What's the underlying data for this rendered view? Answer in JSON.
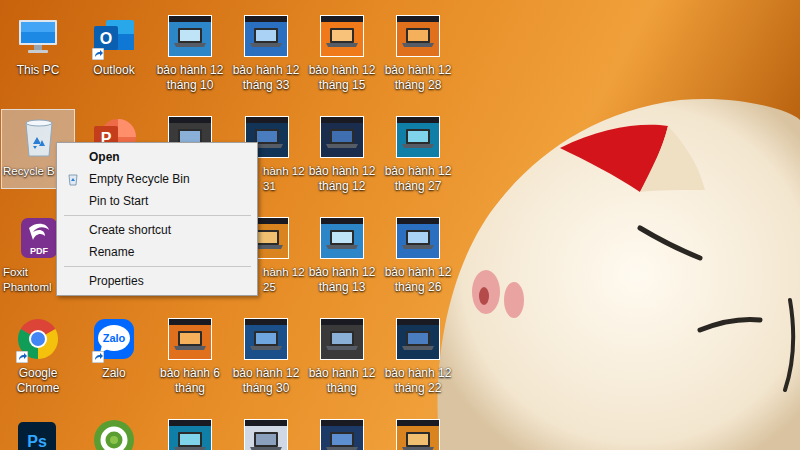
{
  "desktop": {
    "columns": [
      [
        {
          "label": "This PC",
          "kind": "this-pc",
          "glyph": "",
          "shortcut": false,
          "selected": false
        },
        {
          "label": "Recycle B",
          "kind": "recycle-bin",
          "glyph": "",
          "shortcut": false,
          "selected": true
        },
        {
          "label": "Foxit\nPhantoml",
          "kind": "foxit",
          "glyph": "PDF",
          "shortcut": false,
          "selected": false
        },
        {
          "label": "Google Chrome",
          "kind": "chrome",
          "glyph": "",
          "shortcut": true,
          "selected": false
        },
        {
          "label": "",
          "kind": "photoshop",
          "glyph": "Ps",
          "shortcut": false,
          "selected": false
        }
      ],
      [
        {
          "label": "Outlook",
          "kind": "outlook",
          "glyph": "O",
          "shortcut": true,
          "selected": false
        },
        {
          "label": "",
          "kind": "powerpoint",
          "glyph": "P",
          "shortcut": false,
          "selected": false
        },
        {
          "label": "",
          "kind": "blank",
          "glyph": "",
          "shortcut": false,
          "selected": false
        },
        {
          "label": "Zalo",
          "kind": "zalo",
          "glyph": "Zalo",
          "shortcut": true,
          "selected": false
        },
        {
          "label": "",
          "kind": "coccoc",
          "glyph": "",
          "shortcut": false,
          "selected": false
        }
      ],
      [
        {
          "label": "bảo hành 12 tháng 10",
          "kind": "thumbnail",
          "glyph": "",
          "shortcut": false,
          "selected": false
        },
        {
          "label": "",
          "kind": "thumbnail",
          "glyph": "",
          "shortcut": false,
          "selected": false
        },
        {
          "label": "",
          "kind": "blank",
          "glyph": "",
          "shortcut": false,
          "selected": false
        },
        {
          "label": "bảo hành 6 tháng",
          "kind": "thumbnail",
          "glyph": "",
          "shortcut": false,
          "selected": false
        },
        {
          "label": "",
          "kind": "thumbnail",
          "glyph": "",
          "shortcut": false,
          "selected": false
        }
      ],
      [
        {
          "label": "bảo hành 12 tháng 33",
          "kind": "thumbnail",
          "glyph": "",
          "shortcut": false,
          "selected": false
        },
        {
          "label": "hành 12\n31",
          "kind": "thumbnail",
          "glyph": "",
          "shortcut": false,
          "selected": false
        },
        {
          "label": "hành 12\n25",
          "kind": "thumbnail",
          "glyph": "",
          "shortcut": false,
          "selected": false
        },
        {
          "label": "bảo hành 12 tháng 30",
          "kind": "thumbnail",
          "glyph": "",
          "shortcut": false,
          "selected": false
        },
        {
          "label": "",
          "kind": "thumbnail",
          "glyph": "",
          "shortcut": false,
          "selected": false
        }
      ],
      [
        {
          "label": "bảo hành 12 tháng 15",
          "kind": "thumbnail",
          "glyph": "",
          "shortcut": false,
          "selected": false
        },
        {
          "label": "bảo hành 12 tháng 12",
          "kind": "thumbnail",
          "glyph": "",
          "shortcut": false,
          "selected": false
        },
        {
          "label": "bảo hành 12 tháng 13",
          "kind": "thumbnail",
          "glyph": "",
          "shortcut": false,
          "selected": false
        },
        {
          "label": "bảo hành 12 tháng",
          "kind": "thumbnail",
          "glyph": "",
          "shortcut": false,
          "selected": false
        },
        {
          "label": "",
          "kind": "thumbnail",
          "glyph": "",
          "shortcut": false,
          "selected": false
        }
      ],
      [
        {
          "label": "bảo hành 12 tháng 28",
          "kind": "thumbnail",
          "glyph": "",
          "shortcut": false,
          "selected": false
        },
        {
          "label": "bảo hành 12 tháng 27",
          "kind": "thumbnail",
          "glyph": "",
          "shortcut": false,
          "selected": false
        },
        {
          "label": "bảo hành 12 tháng 26",
          "kind": "thumbnail",
          "glyph": "",
          "shortcut": false,
          "selected": false
        },
        {
          "label": "bảo hành 12 tháng 22",
          "kind": "thumbnail",
          "glyph": "",
          "shortcut": false,
          "selected": false
        },
        {
          "label": "",
          "kind": "thumbnail",
          "glyph": "",
          "shortcut": false,
          "selected": false
        }
      ]
    ]
  },
  "context_menu": {
    "groups": [
      [
        {
          "label": "Open",
          "bold": true,
          "kind": "plain"
        },
        {
          "label": "Empty Recycle Bin",
          "bold": false,
          "kind": "icon"
        },
        {
          "label": "Pin to Start",
          "bold": false,
          "kind": "plain"
        }
      ],
      [
        {
          "label": "Create shortcut",
          "bold": false,
          "kind": "plain"
        },
        {
          "label": "Rename",
          "bold": false,
          "kind": "plain"
        }
      ],
      [
        {
          "label": "Properties",
          "bold": false,
          "kind": "plain"
        }
      ]
    ]
  }
}
